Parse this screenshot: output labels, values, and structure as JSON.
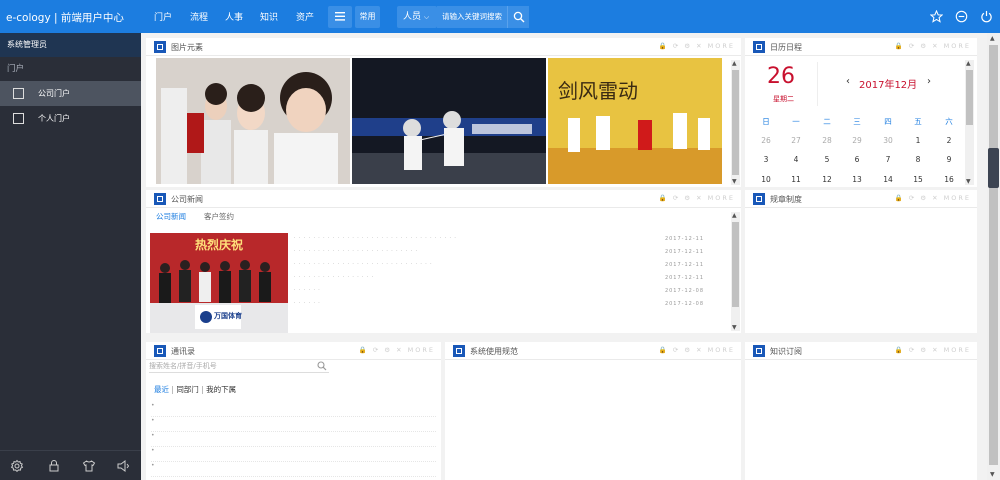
{
  "topbar": {
    "logo": "e-cology | 前端用户中心",
    "nav": [
      "门户",
      "流程",
      "人事",
      "知识",
      "资产"
    ],
    "common_label": "常用",
    "people_label": "人员",
    "search_placeholder": "请输入关键词搜索"
  },
  "sidebar": {
    "user": "系统管理员",
    "section": "门户",
    "items": [
      {
        "label": "公司门户",
        "active": true
      },
      {
        "label": "个人门户",
        "active": false
      }
    ]
  },
  "panels": {
    "images": {
      "title": "图片元素",
      "tools": "MORE"
    },
    "calendar": {
      "title": "日历日程",
      "tools": "MORE"
    },
    "news": {
      "title": "公司新闻",
      "tools": "MORE",
      "tabs": [
        "公司新闻",
        "客户签约"
      ]
    },
    "rules": {
      "title": "规章制度",
      "tools": "MORE"
    },
    "contacts": {
      "title": "通讯录",
      "tools": "MORE",
      "search_placeholder": "搜索姓名/拼音/手机号",
      "filters": [
        "最近",
        "同部门",
        "我的下属"
      ]
    },
    "norms": {
      "title": "系统使用规范",
      "tools": "MORE"
    },
    "rss": {
      "title": "知识订阅",
      "tools": "MORE"
    }
  },
  "calendar": {
    "day": "26",
    "weekday": "星期二",
    "month": "2017年12月",
    "weekdays": [
      "日",
      "一",
      "二",
      "三",
      "四",
      "五",
      "六"
    ],
    "rows": [
      [
        "26",
        "27",
        "28",
        "29",
        "30",
        "1",
        "2"
      ],
      [
        "3",
        "4",
        "5",
        "6",
        "7",
        "8",
        "9"
      ],
      [
        "10",
        "11",
        "12",
        "13",
        "14",
        "15",
        "16"
      ]
    ]
  },
  "news_photo": {
    "banner": "热烈庆祝",
    "sign": "万国体育"
  },
  "news_dates": [
    "2017-12-11",
    "2017-12-11",
    "2017-12-11",
    "2017-12-11",
    "2017-12-08",
    "2017-12-08"
  ],
  "colors": {
    "brand": "#1c7de0",
    "sidebar": "#2a2e38",
    "accent_red": "#c8102e",
    "panel_icon": "#1958b8"
  }
}
